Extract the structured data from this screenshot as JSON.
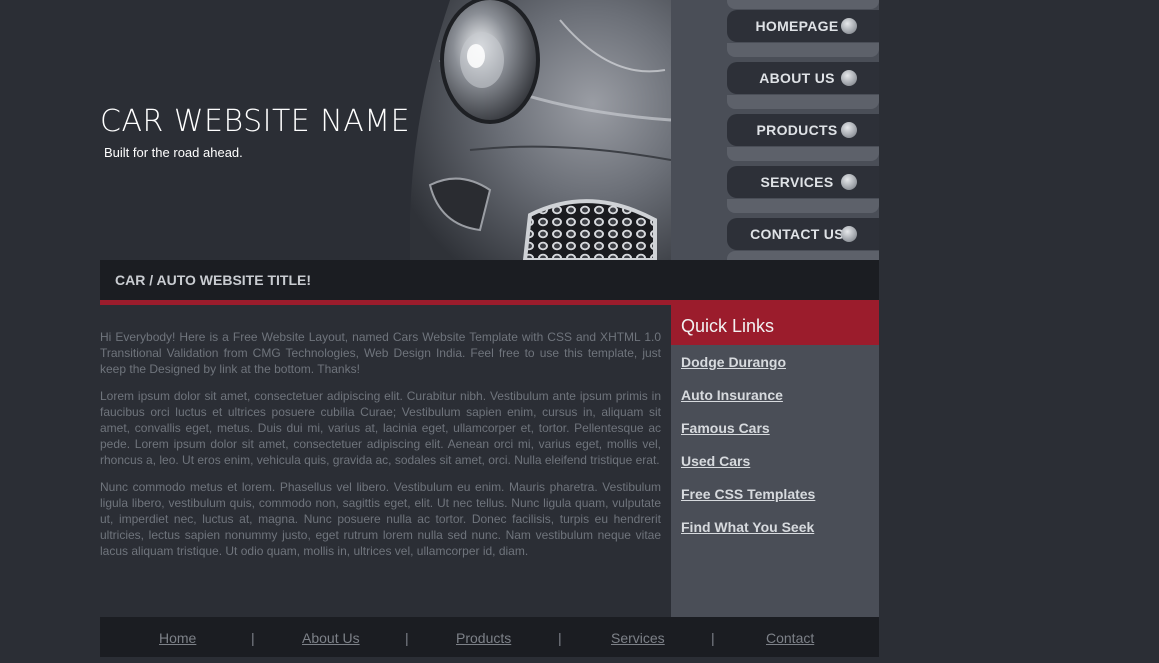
{
  "header": {
    "site_name": "CAR WEBSITE NAME",
    "tagline": "Built for the road ahead."
  },
  "nav": {
    "items": [
      {
        "label": "HOMEPAGE"
      },
      {
        "label": "ABOUT US"
      },
      {
        "label": "PRODUCTS"
      },
      {
        "label": "SERVICES"
      },
      {
        "label": "CONTACT US"
      }
    ]
  },
  "main": {
    "title": "CAR / AUTO WEBSITE TITLE!",
    "paragraphs": [
      "Hi Everybody! Here is a Free Website Layout, named Cars Website Template with CSS and XHTML 1.0 Transitional Validation from CMG Technologies, Web Design India. Feel free to use this template, just keep the Designed by link at the bottom. Thanks!",
      "Lorem ipsum dolor sit amet, consectetuer adipiscing elit. Curabitur nibh. Vestibulum ante ipsum primis in faucibus orci luctus et ultrices posuere cubilia Curae; Vestibulum sapien enim, cursus in, aliquam sit amet, convallis eget, metus. Duis dui mi, varius at, lacinia eget, ullamcorper et, tortor. Pellentesque ac pede. Lorem ipsum dolor sit amet, consectetuer adipiscing elit. Aenean orci mi, varius eget, mollis vel, rhoncus a, leo. Ut eros enim, vehicula quis, gravida ac, sodales sit amet, orci. Nulla eleifend tristique erat.",
      "Nunc commodo metus et lorem. Phasellus vel libero. Vestibulum eu enim. Mauris pharetra. Vestibulum ligula libero, vestibulum quis, commodo non, sagittis eget, elit. Ut nec tellus. Nunc ligula quam, vulputate ut, imperdiet nec, luctus at, magna. Nunc posuere nulla ac tortor. Donec facilisis, turpis eu hendrerit ultricies, lectus sapien nonummy justo, eget rutrum lorem nulla sed nunc. Nam vestibulum neque vitae lacus aliquam tristique. Ut odio quam, mollis in, ultrices vel, ullamcorper id, diam."
    ]
  },
  "sidebar": {
    "title": "Quick Links",
    "links": [
      {
        "label": "Dodge Durango"
      },
      {
        "label": "Auto Insurance"
      },
      {
        "label": "Famous Cars"
      },
      {
        "label": "Used Cars"
      },
      {
        "label": "Free CSS Templates"
      },
      {
        "label": "Find What You Seek"
      }
    ]
  },
  "footer": {
    "links": [
      {
        "label": "Home"
      },
      {
        "label": "About Us"
      },
      {
        "label": "Products"
      },
      {
        "label": "Services"
      },
      {
        "label": "Contact"
      }
    ],
    "separator": "|"
  },
  "colors": {
    "background": "#2b2e35",
    "accent_red": "#9b1c2c",
    "panel_gray": "#4a4e57",
    "bar_dark": "#1b1d22"
  }
}
